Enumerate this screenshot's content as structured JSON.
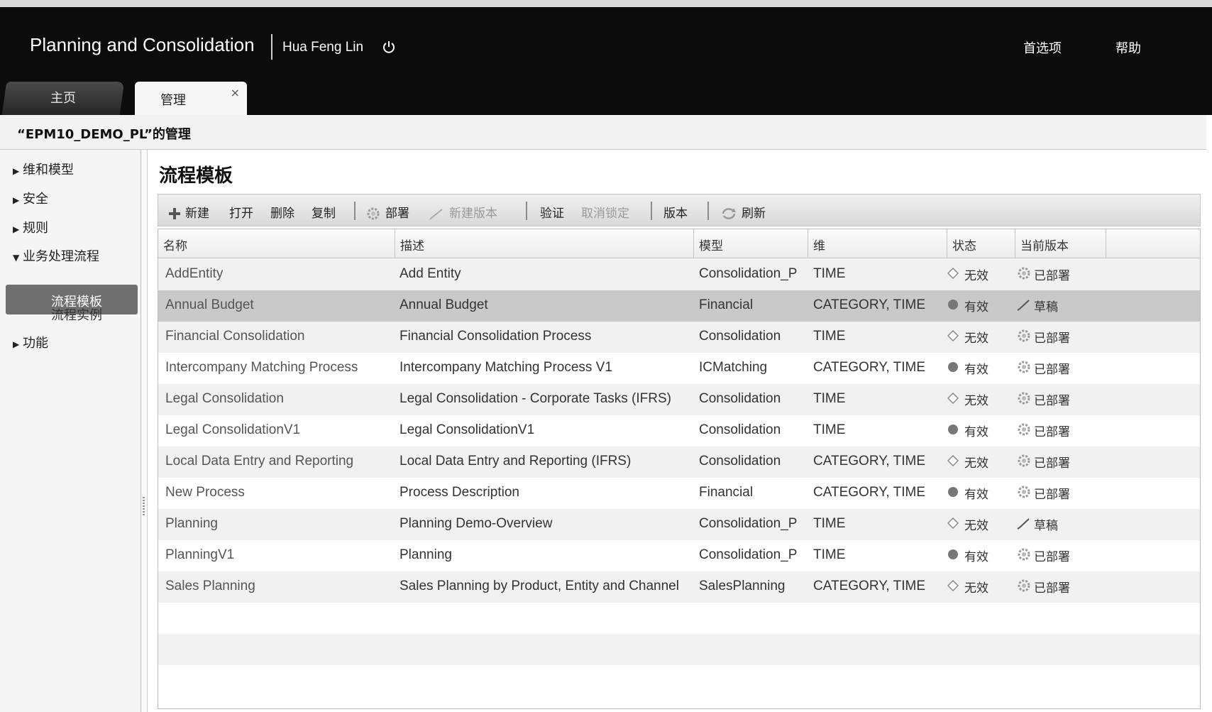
{
  "header": {
    "app_title": "Planning and Consolidation",
    "user_name": "Hua Feng Lin",
    "preferences": "首选项",
    "help": "帮助",
    "icons": {
      "power": "power-icon"
    }
  },
  "tabs": [
    {
      "label": "主页",
      "active": false
    },
    {
      "label": "管理",
      "active": true,
      "close": "×"
    }
  ],
  "context_title": "“EPM10_DEMO_PL”的管理",
  "sidebar": {
    "items": [
      {
        "label": "维和模型",
        "expanded": false
      },
      {
        "label": "安全",
        "expanded": false
      },
      {
        "label": "规则",
        "expanded": false
      },
      {
        "label": "业务处理流程",
        "expanded": true
      },
      {
        "label": "功能",
        "expanded": false
      }
    ],
    "sub_items": [
      {
        "label": "流程模板",
        "selected": true
      },
      {
        "label": "流程实例",
        "selected": false
      }
    ]
  },
  "main": {
    "title": "流程模板",
    "toolbar": {
      "new": "新建",
      "open": "打开",
      "delete": "删除",
      "copy": "复制",
      "deploy": "部署",
      "new_version": "新建版本",
      "validate": "验证",
      "unlock": "取消锁定",
      "version": "版本",
      "refresh": "刷新"
    },
    "columns": [
      "名称",
      "描述",
      "模型",
      "维",
      "状态",
      "当前版本"
    ],
    "rows": [
      {
        "name": "AddEntity",
        "desc": "Add Entity",
        "model": "Consolidation_P",
        "dims": "TIME",
        "status": "无效",
        "status_kind": "invalid",
        "version": "已部署",
        "version_kind": "deployed"
      },
      {
        "name": "Annual Budget",
        "desc": "Annual Budget",
        "model": "Financial",
        "dims": "CATEGORY, TIME",
        "status": "有效",
        "status_kind": "valid",
        "version": "草稿",
        "version_kind": "draft"
      },
      {
        "name": "Financial Consolidation",
        "desc": "Financial Consolidation Process",
        "model": "Consolidation",
        "dims": "TIME",
        "status": "无效",
        "status_kind": "invalid",
        "version": "已部署",
        "version_kind": "deployed"
      },
      {
        "name": "Intercompany Matching Process",
        "desc": "Intercompany Matching Process V1",
        "model": "ICMatching",
        "dims": "CATEGORY, TIME",
        "status": "有效",
        "status_kind": "valid",
        "version": "已部署",
        "version_kind": "deployed"
      },
      {
        "name": "Legal Consolidation",
        "desc": "Legal Consolidation - Corporate Tasks (IFRS)",
        "model": "Consolidation",
        "dims": "TIME",
        "status": "无效",
        "status_kind": "invalid",
        "version": "已部署",
        "version_kind": "deployed"
      },
      {
        "name": "Legal ConsolidationV1",
        "desc": "Legal ConsolidationV1",
        "model": "Consolidation",
        "dims": "TIME",
        "status": "有效",
        "status_kind": "valid",
        "version": "已部署",
        "version_kind": "deployed"
      },
      {
        "name": "Local Data Entry and Reporting",
        "desc": "Local Data Entry and Reporting (IFRS)",
        "model": "Consolidation",
        "dims": "CATEGORY, TIME",
        "status": "无效",
        "status_kind": "invalid",
        "version": "已部署",
        "version_kind": "deployed"
      },
      {
        "name": "New Process",
        "desc": "Process Description",
        "model": "Financial",
        "dims": "CATEGORY, TIME",
        "status": "有效",
        "status_kind": "valid",
        "version": "已部署",
        "version_kind": "deployed"
      },
      {
        "name": "Planning",
        "desc": "Planning Demo-Overview",
        "model": "Consolidation_P",
        "dims": "TIME",
        "status": "无效",
        "status_kind": "invalid",
        "version": "草稿",
        "version_kind": "draft"
      },
      {
        "name": "PlanningV1",
        "desc": "Planning",
        "model": "Consolidation_P",
        "dims": "TIME",
        "status": "有效",
        "status_kind": "valid",
        "version": "已部署",
        "version_kind": "deployed"
      },
      {
        "name": "Sales Planning",
        "desc": "Sales Planning by Product, Entity and Channel",
        "model": "SalesPlanning",
        "dims": "CATEGORY, TIME",
        "status": "无效",
        "status_kind": "invalid",
        "version": "已部署",
        "version_kind": "deployed"
      }
    ],
    "selected_row": 1
  }
}
